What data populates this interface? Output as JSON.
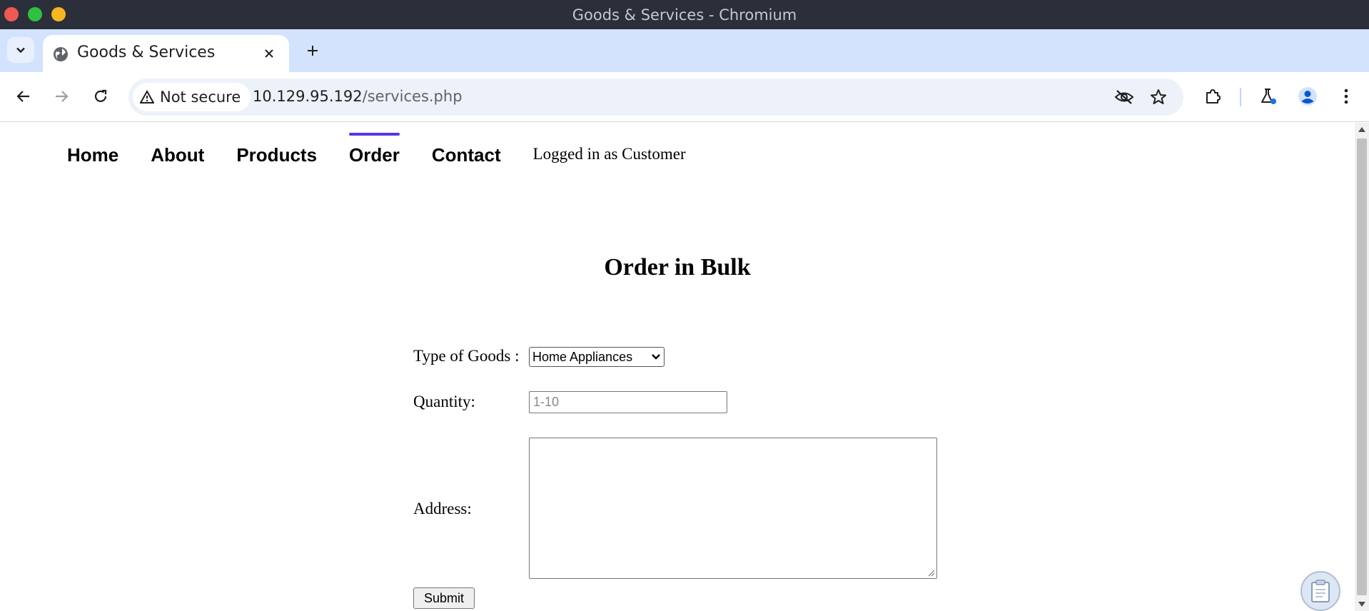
{
  "window": {
    "title": "Goods & Services - Chromium"
  },
  "tab": {
    "title": "Goods & Services"
  },
  "toolbar": {
    "security_label": "Not secure",
    "url_host": "10.129.95.192",
    "url_path": "/services.php"
  },
  "nav": {
    "items": [
      {
        "label": "Home"
      },
      {
        "label": "About"
      },
      {
        "label": "Products"
      },
      {
        "label": "Order"
      },
      {
        "label": "Contact"
      }
    ],
    "active": "Order",
    "user_status": "Logged in as Customer"
  },
  "form": {
    "heading": "Order in Bulk",
    "goods_label": "Type of Goods :",
    "goods_selected": "Home Appliances",
    "quantity_label": "Quantity:",
    "quantity_placeholder": "1-10",
    "address_label": "Address:",
    "submit_label": "Submit"
  },
  "colors": {
    "titlebar": "#2b2f3a",
    "tabstrip": "#d3e3fd",
    "active_indicator": "#5a35e0"
  },
  "icons": [
    "tab-search-icon",
    "globe-icon",
    "close-icon",
    "plus-icon",
    "back-icon",
    "forward-icon",
    "reload-icon",
    "warning-icon",
    "eye-off-icon",
    "star-icon",
    "extensions-icon",
    "labs-flask-icon",
    "profile-icon",
    "kebab-menu-icon",
    "clipboard-icon"
  ]
}
